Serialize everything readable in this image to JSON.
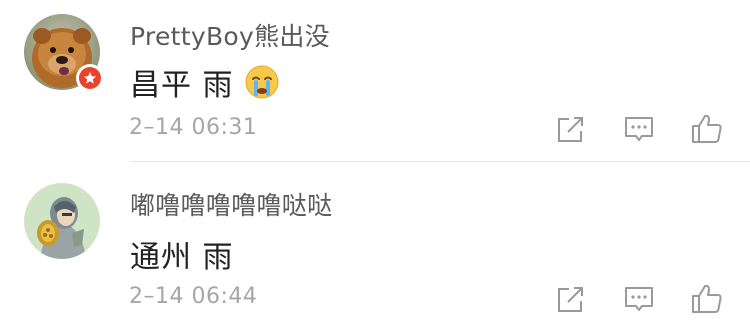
{
  "comments": [
    {
      "username": "PrettyBoy熊出没",
      "content": "昌平 雨",
      "emoji": "crying-face-emoji",
      "timestamp": "2–14 06:31",
      "verified": true
    },
    {
      "username": "嘟噜噜噜噜噜哒哒",
      "content": "通州 雨",
      "timestamp": "2–14 06:44",
      "verified": false
    }
  ],
  "colors": {
    "username": "#5a5a5a",
    "content": "#222222",
    "timestamp": "#a6a6a6",
    "icon": "#9a9a9a",
    "divider": "#e6e6e6",
    "verified_badge": "#e8432f"
  }
}
